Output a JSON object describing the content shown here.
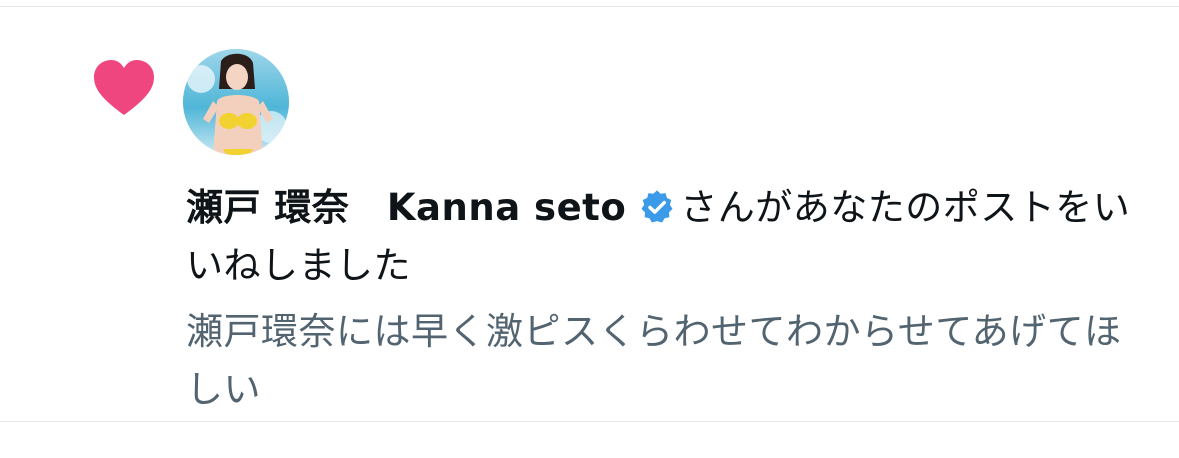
{
  "notification": {
    "user_display_name": "瀬戸 環奈　Kanna seto",
    "action_text": "さんがあなたのポストをいいねしました",
    "post_text": "瀬戸環奈には早く激ピスくらわせてわからせてあげてほしい",
    "heart_icon": "heart-icon",
    "verified_icon": "verified-badge-icon"
  },
  "colors": {
    "heart": "#f0467f",
    "verified": "#3b9be8",
    "text_primary": "#0f1419",
    "text_secondary": "#536471",
    "divider": "#e6e8ea"
  }
}
